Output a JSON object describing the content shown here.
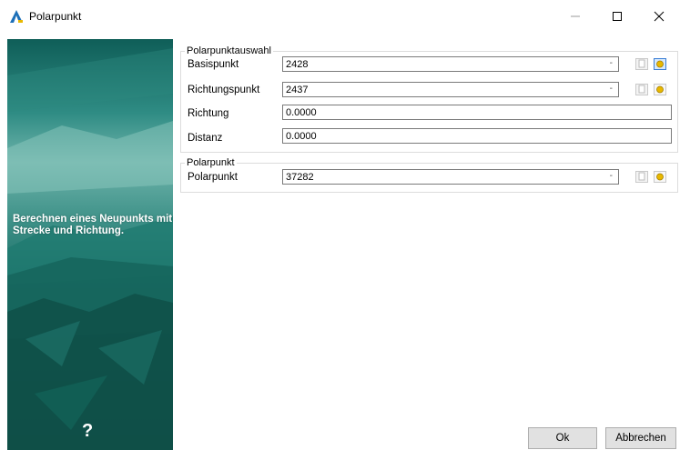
{
  "window": {
    "title": "Polarpunkt"
  },
  "sidebar": {
    "description": "Berechnen eines Neupunkts mit Strecke und Richtung.",
    "help_symbol": "?"
  },
  "groups": {
    "auswahl": {
      "label": "Polarpunktauswahl",
      "basis_label": "Basispunkt",
      "basis_value": "2428",
      "richtungspunkt_label": "Richtungspunkt",
      "richtungspunkt_value": "2437",
      "richtung_label": "Richtung",
      "richtung_value": "0.0000",
      "distanz_label": "Distanz",
      "distanz_value": "0.0000"
    },
    "polarpunkt": {
      "label": "Polarpunkt",
      "polar_label": "Polarpunkt",
      "polar_value": "37282"
    }
  },
  "buttons": {
    "ok": "Ok",
    "cancel": "Abbrechen"
  },
  "colors": {
    "sidebar_teal": "#1d6f67",
    "accent_blue": "#3c7fd6",
    "point_yellow": "#e8b800"
  }
}
